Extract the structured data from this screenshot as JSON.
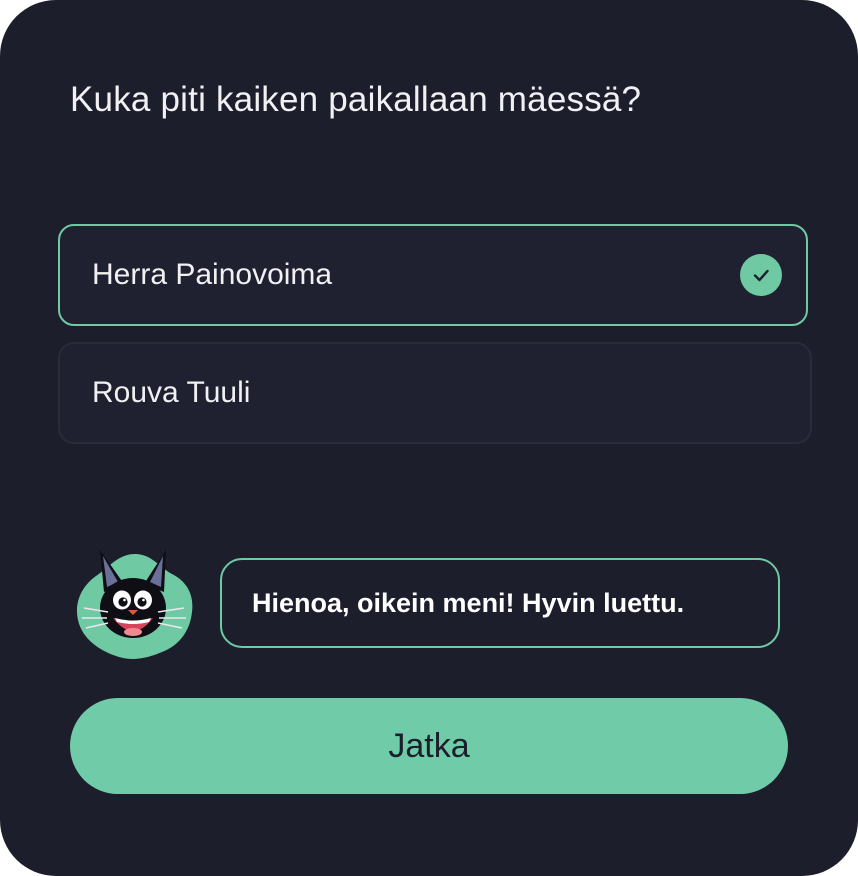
{
  "quiz": {
    "question": "Kuka piti kaiken paikallaan mäessä?",
    "options": [
      {
        "label": "Herra Painovoima",
        "selected": true,
        "correct": true
      },
      {
        "label": "Rouva Tuuli",
        "selected": false
      }
    ]
  },
  "feedback": {
    "message": "Hienoa, oikein meni! Hyvin luettu."
  },
  "actions": {
    "continue_label": "Jatka"
  },
  "colors": {
    "background": "#1d1e2c",
    "accent": "#6fcaa4",
    "text": "#f1f1f4"
  }
}
